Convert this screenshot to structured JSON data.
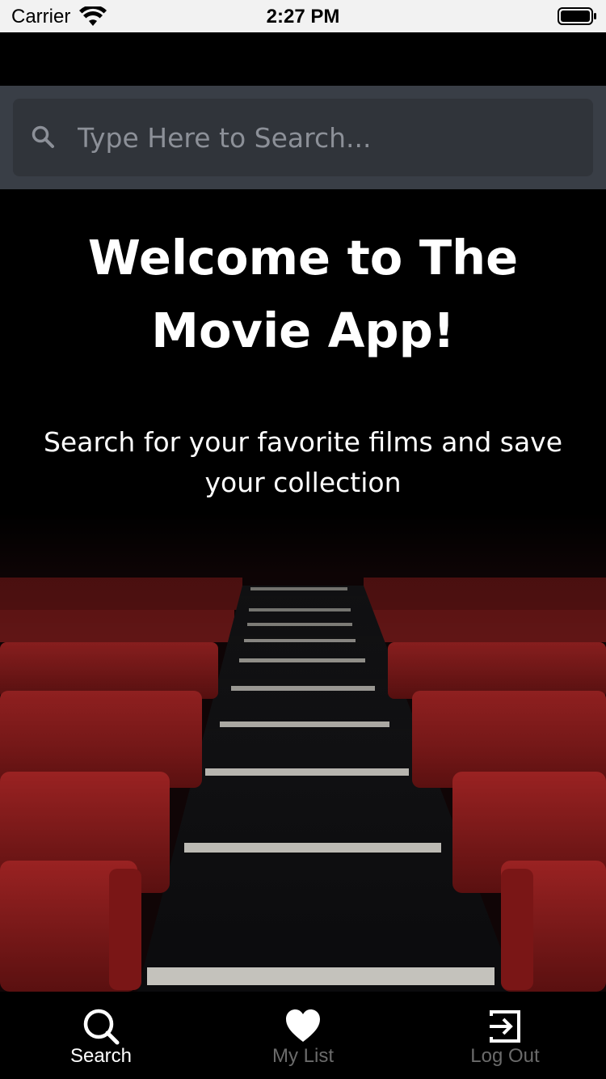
{
  "status_bar": {
    "carrier": "Carrier",
    "time": "2:27 PM",
    "icons": [
      "wifi-icon",
      "battery-icon"
    ]
  },
  "search": {
    "placeholder": "Type Here to Search...",
    "value": "",
    "icon": "search-icon"
  },
  "hero": {
    "title": "Welcome to The Movie App!",
    "subtitle": "Search for your favorite films and save your collection",
    "image": "theater-seats-stairs-image"
  },
  "tab_bar": {
    "tabs": [
      {
        "label": "Search",
        "icon": "search-icon",
        "active": true
      },
      {
        "label": "My List",
        "icon": "heart-icon",
        "active": false
      },
      {
        "label": "Log Out",
        "icon": "logout-icon",
        "active": false
      }
    ]
  },
  "colors": {
    "search_bar_bg": "#393e46",
    "search_field_bg": "#30343a",
    "placeholder": "#8c9098",
    "seat_red": "#8a1c1c",
    "tab_active": "#ffffff",
    "tab_inactive": "#6b6b6b"
  }
}
